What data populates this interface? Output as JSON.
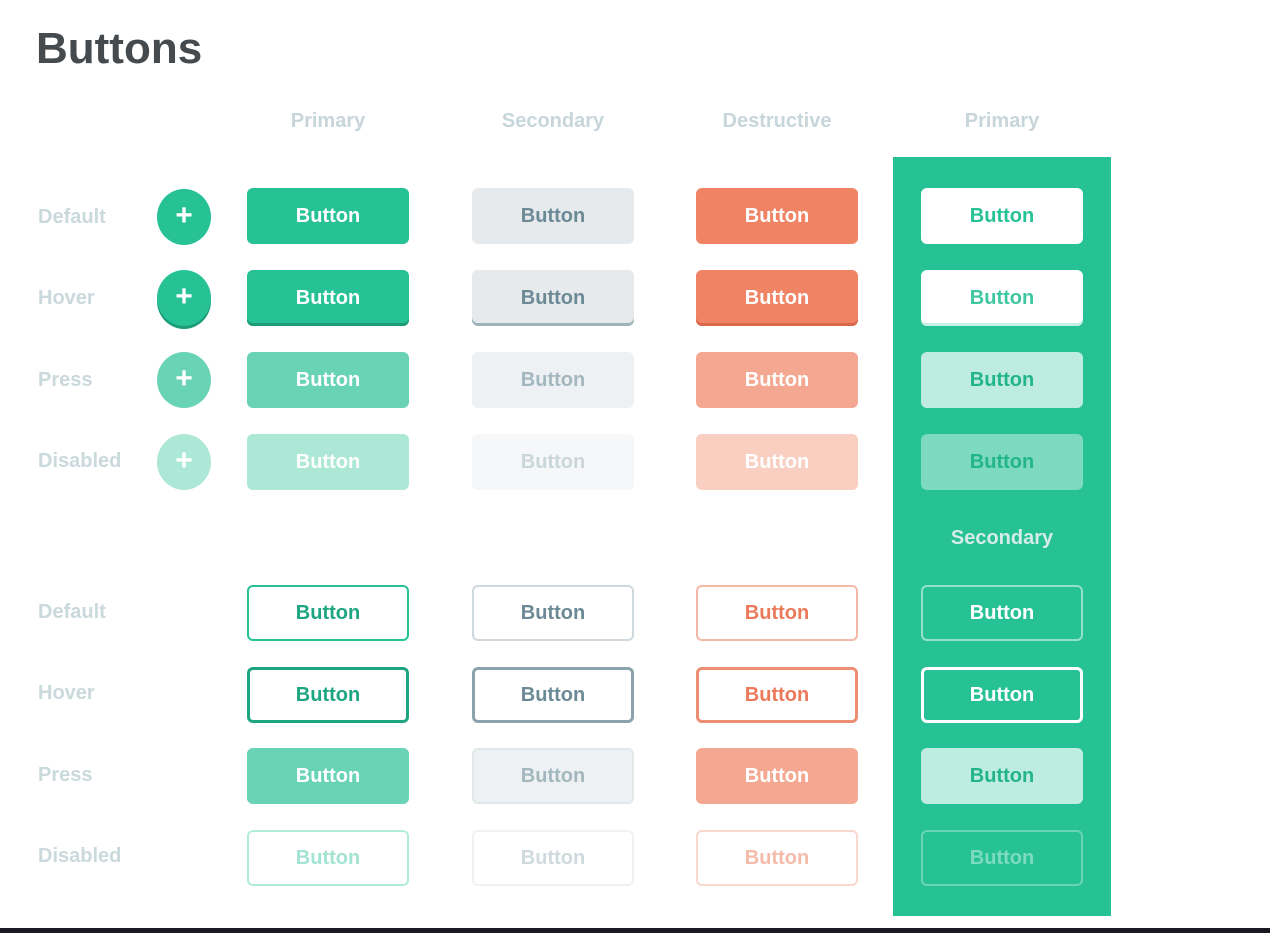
{
  "page": {
    "title": "Buttons"
  },
  "columns": [
    "Primary",
    "Secondary",
    "Destructive",
    "Primary"
  ],
  "panel_secondary_label": "Secondary",
  "states": [
    "Default",
    "Hover",
    "Press",
    "Disabled"
  ],
  "fab_symbol": "+",
  "icons": {
    "fab": "plus-icon"
  },
  "button_label": "Button",
  "colors": {
    "brand_green": "#27c196",
    "destructive": "#ef8364",
    "secondary_text": "#6c8a96",
    "label_gray": "#cad9dc"
  }
}
